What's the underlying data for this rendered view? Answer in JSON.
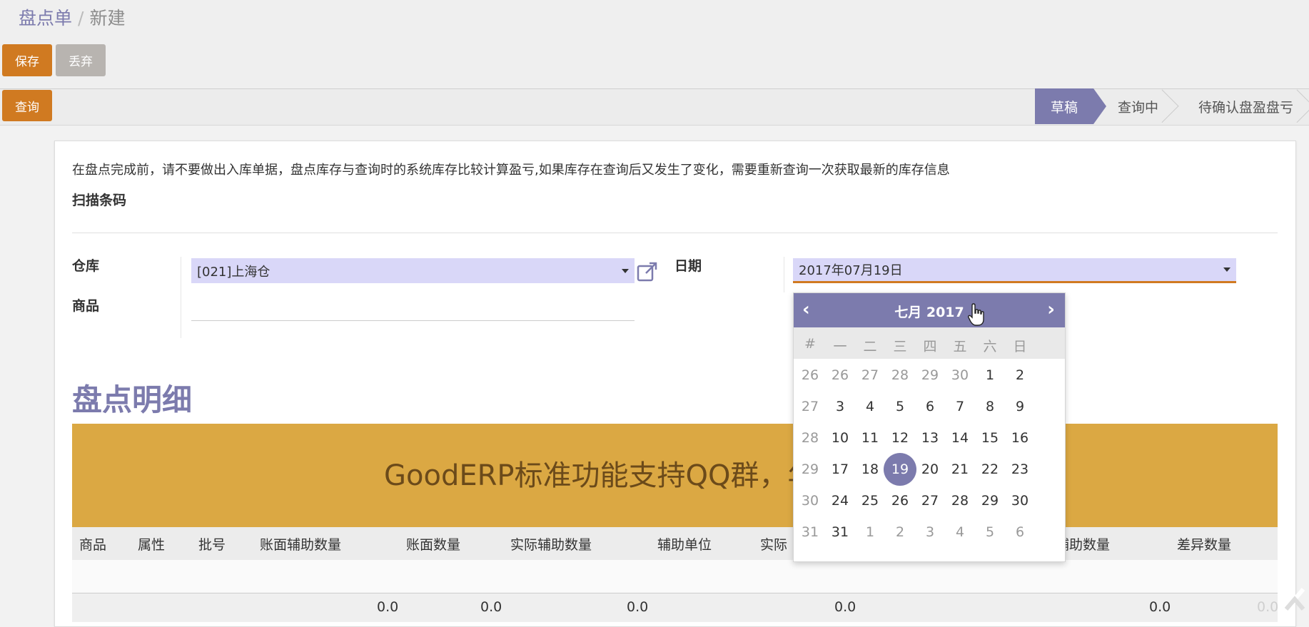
{
  "breadcrumb": {
    "root": "盘点单",
    "separator": "/",
    "current": "新建"
  },
  "toolbar": {
    "save_label": "保存",
    "discard_label": "丢弃",
    "query_label": "查询"
  },
  "status": {
    "stages": [
      "草稿",
      "查询中",
      "待确认盘盈盘亏"
    ],
    "active": "草稿"
  },
  "form": {
    "notice": "在盘点完成前，请不要做出入库单据，盘点库存与查询时的系统库存比较计算盈亏,如果库存在查询后又发生了变化，需要重新查询一次获取最新的库存信息",
    "scan_label": "扫描条码",
    "warehouse_label": "仓库",
    "warehouse_value": "[021]上海仓",
    "product_label": "商品",
    "date_label": "日期",
    "date_value": "2017年07月19日"
  },
  "datepicker": {
    "title": "七月 2017",
    "prev": "‹",
    "next": "›",
    "dow": [
      "#",
      "一",
      "二",
      "三",
      "四",
      "五",
      "六",
      "日"
    ],
    "weeks": [
      {
        "wk": "26",
        "days": [
          "26",
          "27",
          "28",
          "29",
          "30",
          "1",
          "2"
        ],
        "muted": [
          true,
          true,
          true,
          true,
          true,
          false,
          false
        ]
      },
      {
        "wk": "27",
        "days": [
          "3",
          "4",
          "5",
          "6",
          "7",
          "8",
          "9"
        ],
        "muted": [
          false,
          false,
          false,
          false,
          false,
          false,
          false
        ]
      },
      {
        "wk": "28",
        "days": [
          "10",
          "11",
          "12",
          "13",
          "14",
          "15",
          "16"
        ],
        "muted": [
          false,
          false,
          false,
          false,
          false,
          false,
          false
        ]
      },
      {
        "wk": "29",
        "days": [
          "17",
          "18",
          "19",
          "20",
          "21",
          "22",
          "23"
        ],
        "muted": [
          false,
          false,
          false,
          false,
          false,
          false,
          false
        ]
      },
      {
        "wk": "30",
        "days": [
          "24",
          "25",
          "26",
          "27",
          "28",
          "29",
          "30"
        ],
        "muted": [
          false,
          false,
          false,
          false,
          false,
          false,
          false
        ]
      },
      {
        "wk": "31",
        "days": [
          "31",
          "1",
          "2",
          "3",
          "4",
          "5",
          "6"
        ],
        "muted": [
          false,
          true,
          true,
          true,
          true,
          true,
          true
        ]
      }
    ],
    "selected_day": "19"
  },
  "details": {
    "title": "盘点明细",
    "banner": "GoodERP标准功能支持QQ群，年",
    "columns": [
      "商品",
      "属性",
      "批号",
      "账面辅助数量",
      "账面数量",
      "实际辅助数量",
      "辅助单位",
      "实际",
      "辅助数量",
      "差异数量"
    ],
    "totals": [
      "0.0",
      "0.0",
      "0.0",
      "0.0",
      "0.0",
      "0.0"
    ]
  },
  "colors": {
    "accent": "#7c7bad",
    "primary_button": "#d07a21",
    "banner": "#dba843",
    "select_bg": "#d9d7f8"
  }
}
